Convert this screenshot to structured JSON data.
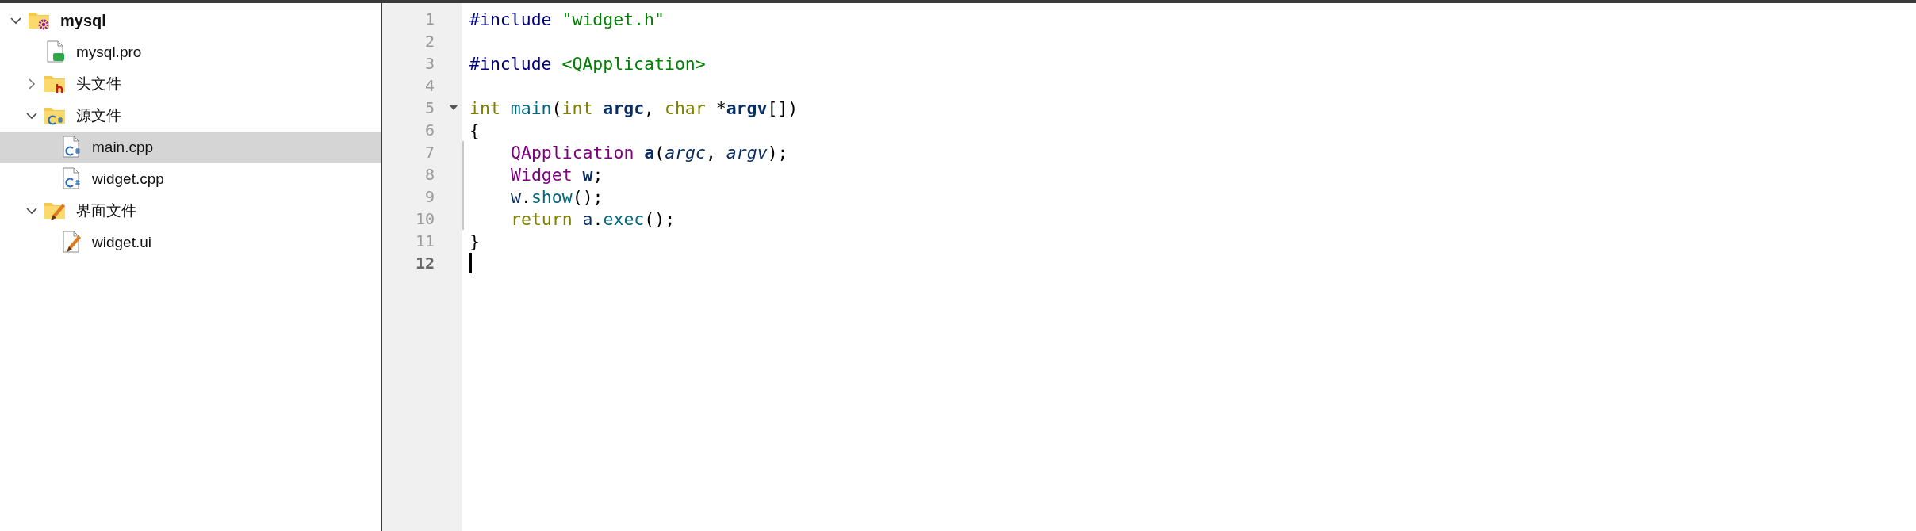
{
  "project_tree": [
    {
      "label": "mysql",
      "kind": "project",
      "expanded": true,
      "selected": false,
      "children": [
        {
          "label": "mysql.pro",
          "kind": "pro",
          "selected": false
        },
        {
          "label": "头文件",
          "kind": "headers",
          "expanded": false,
          "selected": false
        },
        {
          "label": "源文件",
          "kind": "sources",
          "expanded": true,
          "selected": false,
          "children": [
            {
              "label": "main.cpp",
              "kind": "cpp",
              "selected": true
            },
            {
              "label": "widget.cpp",
              "kind": "cpp",
              "selected": false
            }
          ]
        },
        {
          "label": "界面文件",
          "kind": "forms",
          "expanded": true,
          "selected": false,
          "children": [
            {
              "label": "widget.ui",
              "kind": "ui",
              "selected": false
            }
          ]
        }
      ]
    }
  ],
  "editor": {
    "lines": [
      {
        "number": "1",
        "current": false,
        "foldable": false,
        "in_block": false,
        "tokens": [
          {
            "kind": "preproc",
            "text": "#include "
          },
          {
            "kind": "string",
            "text": "\"widget.h\""
          }
        ]
      },
      {
        "number": "2",
        "current": false,
        "foldable": false,
        "in_block": false
      },
      {
        "number": "3",
        "current": false,
        "foldable": false,
        "in_block": false,
        "tokens": [
          {
            "kind": "preproc",
            "text": "#include "
          },
          {
            "kind": "string",
            "text": "<QApplication>"
          }
        ]
      },
      {
        "number": "4",
        "current": false,
        "foldable": false,
        "in_block": false
      },
      {
        "number": "5",
        "current": false,
        "foldable": true,
        "in_block": false,
        "tokens": [
          {
            "kind": "keyword",
            "text": "int "
          },
          {
            "kind": "func",
            "text": "main"
          },
          {
            "kind": "plain",
            "text": "("
          },
          {
            "kind": "keyword",
            "text": "int "
          },
          {
            "kind": "local",
            "text": "argc"
          },
          {
            "kind": "plain",
            "text": ", "
          },
          {
            "kind": "keyword",
            "text": "char "
          },
          {
            "kind": "plain",
            "text": "*"
          },
          {
            "kind": "local",
            "text": "argv"
          },
          {
            "kind": "plain",
            "text": "[])"
          }
        ]
      },
      {
        "number": "6",
        "current": false,
        "foldable": false,
        "in_block": false,
        "tokens": [
          {
            "kind": "plain",
            "text": "{"
          }
        ]
      },
      {
        "number": "7",
        "current": false,
        "foldable": false,
        "in_block": true,
        "tokens": [
          {
            "kind": "type",
            "text": "QApplication "
          },
          {
            "kind": "local",
            "text": "a"
          },
          {
            "kind": "plain",
            "text": "("
          },
          {
            "kind": "param",
            "text": "argc"
          },
          {
            "kind": "plain",
            "text": ", "
          },
          {
            "kind": "param",
            "text": "argv"
          },
          {
            "kind": "plain",
            "text": ");"
          }
        ]
      },
      {
        "number": "8",
        "current": false,
        "foldable": false,
        "in_block": true,
        "tokens": [
          {
            "kind": "type",
            "text": "Widget "
          },
          {
            "kind": "local",
            "text": "w"
          },
          {
            "kind": "plain",
            "text": ";"
          }
        ]
      },
      {
        "number": "9",
        "current": false,
        "foldable": false,
        "in_block": true,
        "tokens": [
          {
            "kind": "var",
            "text": "w"
          },
          {
            "kind": "plain",
            "text": "."
          },
          {
            "kind": "func",
            "text": "show"
          },
          {
            "kind": "plain",
            "text": "();"
          }
        ]
      },
      {
        "number": "10",
        "current": false,
        "foldable": false,
        "in_block": true,
        "tokens": [
          {
            "kind": "keyword",
            "text": "return "
          },
          {
            "kind": "var",
            "text": "a"
          },
          {
            "kind": "plain",
            "text": "."
          },
          {
            "kind": "func",
            "text": "exec"
          },
          {
            "kind": "plain",
            "text": "();"
          }
        ]
      },
      {
        "number": "11",
        "current": false,
        "foldable": false,
        "in_block": false,
        "tokens": [
          {
            "kind": "plain",
            "text": "}"
          }
        ]
      },
      {
        "number": "12",
        "current": true,
        "foldable": false,
        "in_block": false
      }
    ]
  }
}
